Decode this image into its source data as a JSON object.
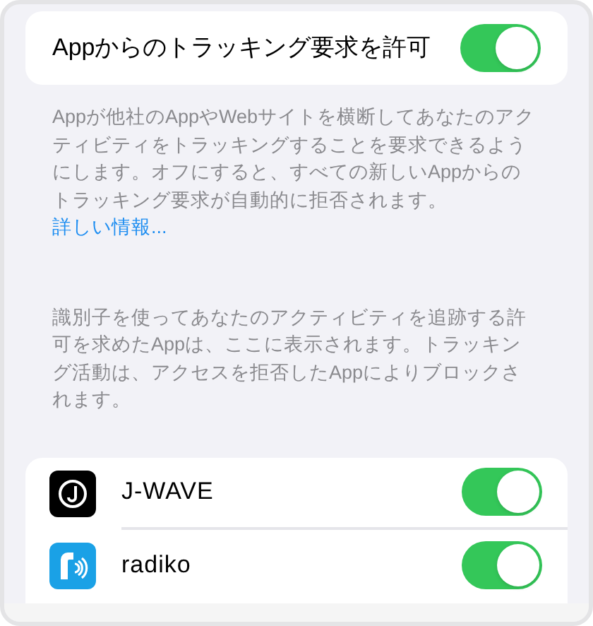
{
  "main_toggle": {
    "label": "Appからのトラッキング要求を許可",
    "on": true
  },
  "description": {
    "text": "Appが他社のAppやWebサイトを横断してあなたのアクティビティをトラッキングすることを要求できるようにします。オフにすると、すべての新しいAppからのトラッキング要求が自動的に拒否されます。",
    "link": "詳しい情報..."
  },
  "apps_note": "識別子を使ってあなたのアクティビティを追跡する許可を求めたAppは、ここに表示されます。トラッキング活動は、アクセスを拒否したAppによりブロックされます。",
  "apps": [
    {
      "name": "J-WAVE",
      "kind": "ring",
      "on": true
    },
    {
      "name": "radiko",
      "kind": "radio",
      "on": true
    }
  ]
}
